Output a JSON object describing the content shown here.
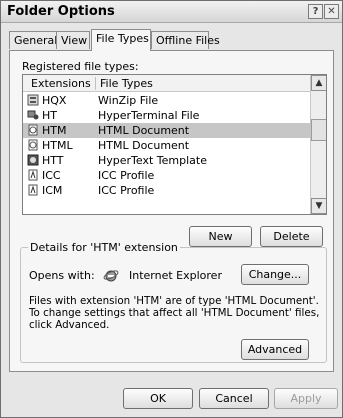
{
  "window": {
    "title": "Folder Options",
    "help_glyph": "?",
    "close_glyph": "✕"
  },
  "tabs": [
    {
      "label": "General"
    },
    {
      "label": "View"
    },
    {
      "label": "File Types",
      "active": true
    },
    {
      "label": "Offline Files"
    }
  ],
  "file_types": {
    "registered_label": "Registered file types:",
    "columns": [
      "Extensions",
      "File Types"
    ],
    "rows": [
      {
        "ext": "HQX",
        "type": "WinZip File",
        "icon": "winzip-icon"
      },
      {
        "ext": "HT",
        "type": "HyperTerminal File",
        "icon": "hyperterminal-icon"
      },
      {
        "ext": "HTM",
        "type": "HTML Document",
        "icon": "html-document-icon",
        "selected": true
      },
      {
        "ext": "HTML",
        "type": "HTML Document",
        "icon": "html-document-icon"
      },
      {
        "ext": "HTT",
        "type": "HyperText Template",
        "icon": "template-icon"
      },
      {
        "ext": "ICC",
        "type": "ICC Profile",
        "icon": "icc-profile-icon"
      },
      {
        "ext": "ICM",
        "type": "ICC Profile",
        "icon": "icc-profile-icon"
      }
    ],
    "scroll_up_glyph": "▲",
    "scroll_down_glyph": "▼"
  },
  "buttons": {
    "new": "New",
    "delete": "Delete",
    "change": "Change...",
    "advanced": "Advanced",
    "ok": "OK",
    "cancel": "Cancel",
    "apply": "Apply"
  },
  "details": {
    "group_title": "Details for 'HTM' extension",
    "opens_with_label": "Opens with:",
    "app_name": "Internet Explorer",
    "app_icon": "internet-explorer-icon",
    "description": "Files with extension 'HTM' are of type 'HTML Document'.  To change settings that affect all 'HTML Document' files, click Advanced."
  },
  "colors": {
    "selection": "#c6c6c6",
    "panel": "#f6f6f6",
    "dialog": "#e6e6e6"
  }
}
